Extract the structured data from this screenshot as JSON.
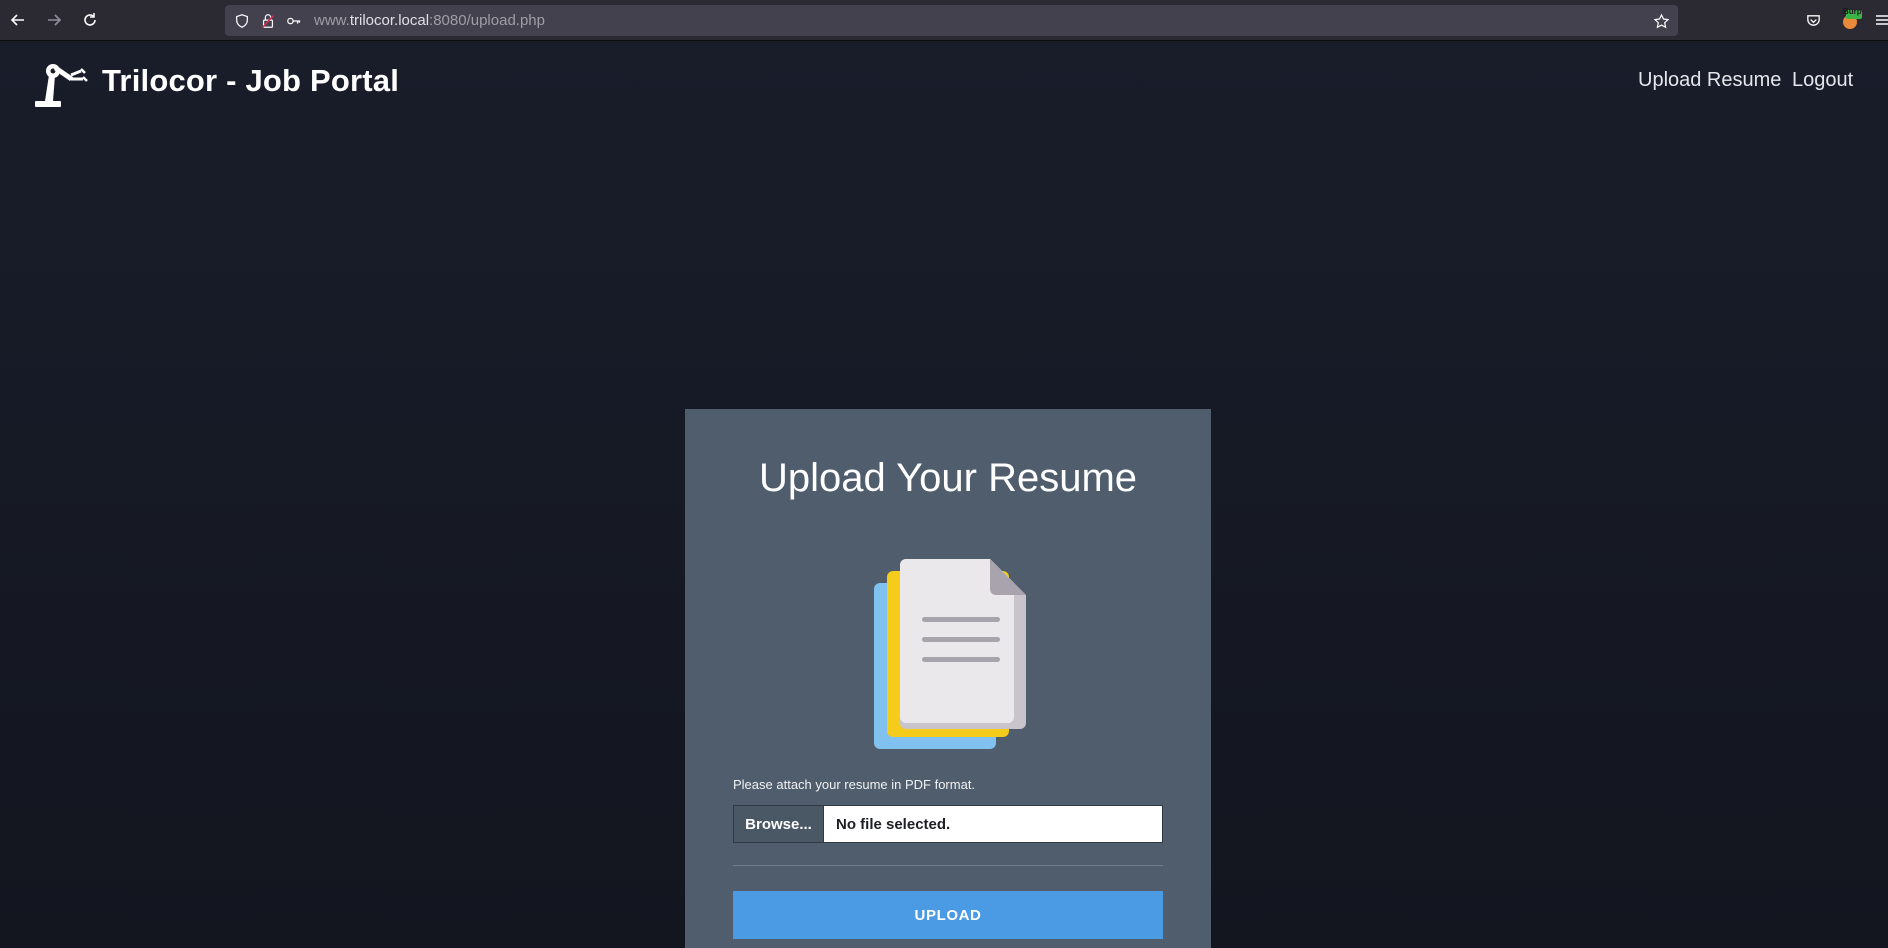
{
  "browser": {
    "url_prefix": "www.",
    "url_host": "trilocor.local",
    "url_rest": ":8080/upload.php",
    "extension_badge": "Burp"
  },
  "site": {
    "title": "Trilocor - Job Portal",
    "nav": [
      "Upload Resume",
      "Logout"
    ]
  },
  "upload": {
    "heading": "Upload Your Resume",
    "hint": "Please attach your resume in PDF format.",
    "browse_label": "Browse...",
    "file_status": "No file selected.",
    "submit_label": "UPLOAD"
  },
  "colors": {
    "page_bg": "#171b27",
    "card_bg": "#4f5d6c",
    "accent": "#4a9ae4"
  }
}
